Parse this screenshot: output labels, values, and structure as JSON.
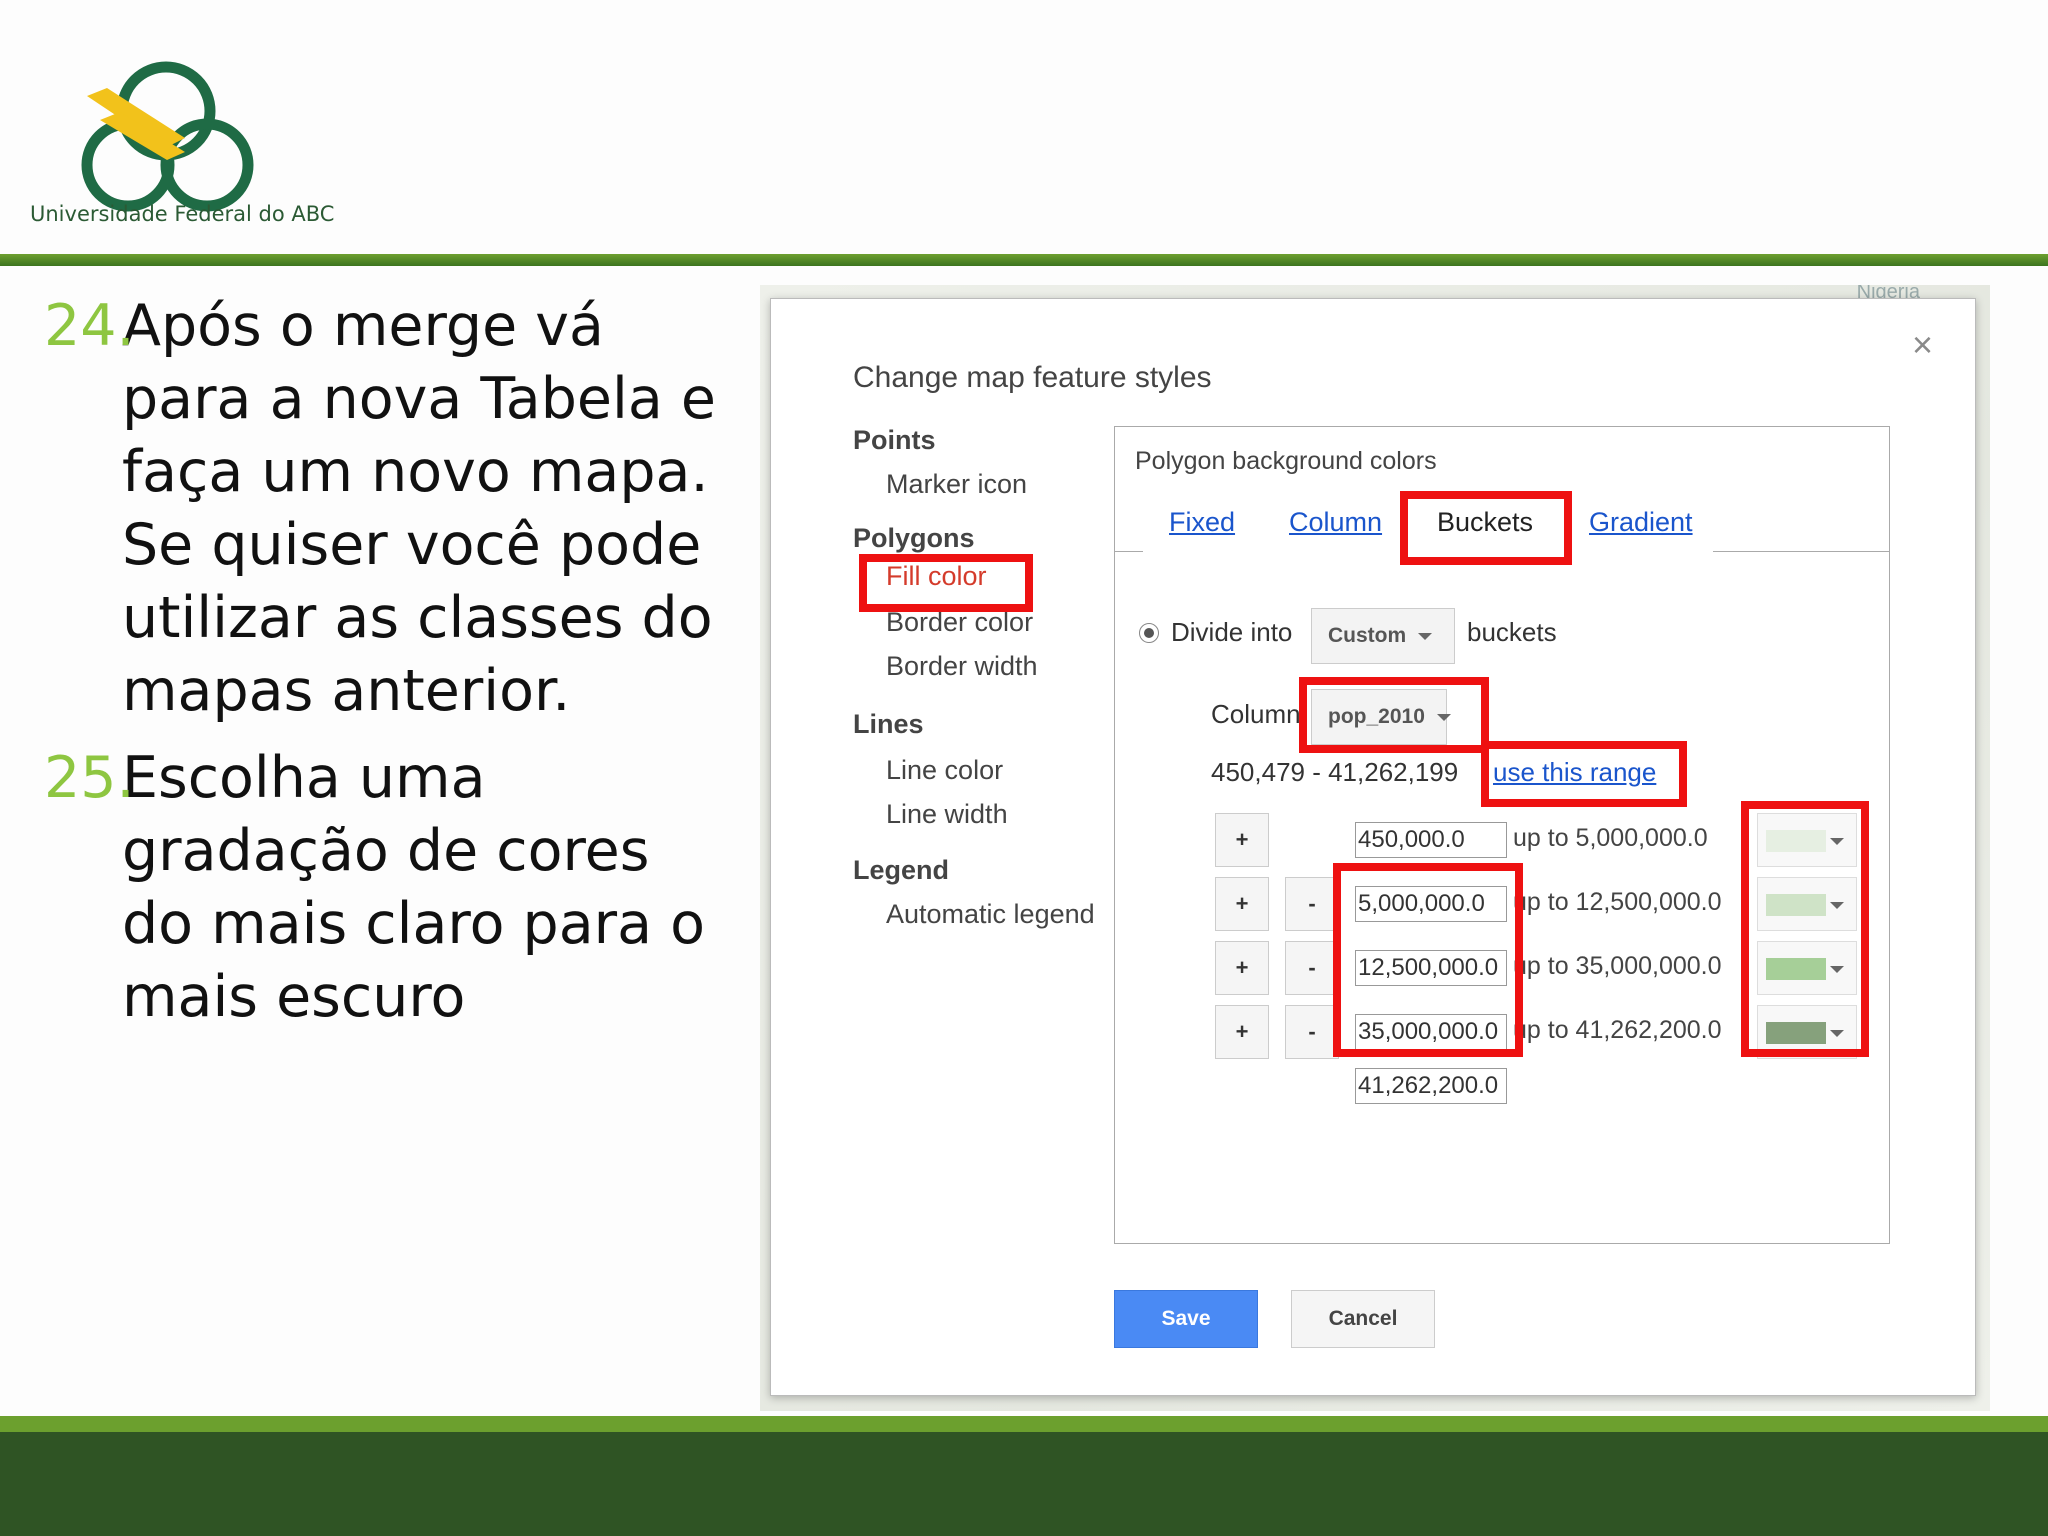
{
  "header": {
    "logo_text": "Universidade Federal do ABC"
  },
  "steps": [
    {
      "num": "24.",
      "first": "Após o merge vá",
      "rest": [
        "para a nova Tabela e",
        "faça um novo mapa.",
        "Se quiser você pode",
        "utilizar as classes do",
        "mapas anterior."
      ]
    },
    {
      "num": "25.",
      "first": "Escolha uma",
      "rest": [
        "gradação de cores",
        "do mais claro para o",
        "mais escuro"
      ]
    }
  ],
  "dialog": {
    "title": "Change map feature styles",
    "close_icon": "×",
    "nav": {
      "points": "Points",
      "marker_icon": "Marker icon",
      "polygons": "Polygons",
      "fill_color": "Fill color",
      "border_color": "Border color",
      "border_width": "Border width",
      "lines": "Lines",
      "line_color": "Line color",
      "line_width": "Line width",
      "legend": "Legend",
      "automatic_legend": "Automatic legend"
    },
    "panel": {
      "title": "Polygon background colors",
      "tabs": [
        "Fixed",
        "Column",
        "Buckets",
        "Gradient"
      ],
      "active_tab": "Buckets",
      "divide_into": "Divide into",
      "divide_select": "Custom",
      "buckets_label": "buckets",
      "column_label": "Column",
      "column_select": "pop_2010",
      "range_text": "450,479 - 41,262,199",
      "use_range_link": "use this range",
      "plus": "+",
      "minus": "-",
      "rows": [
        {
          "from": "450,000.0",
          "upto": "up to 5,000,000.0",
          "color": "#e6efe2",
          "has_minus": false
        },
        {
          "from": "5,000,000.0",
          "upto": "up to 12,500,000.0",
          "color": "#cfe3c7",
          "has_minus": true
        },
        {
          "from": "12,500,000.0",
          "upto": "up to 35,000,000.0",
          "color": "#a6cf98",
          "has_minus": true
        },
        {
          "from": "35,000,000.0",
          "upto": "up to 41,262,200.0",
          "color": "#86a17c",
          "has_minus": true
        }
      ],
      "last_value": "41,262,200.0"
    },
    "save": "Save",
    "cancel": "Cancel"
  },
  "map_label": "Nigeria",
  "colors": {
    "highlight": "#ee1111",
    "green_light": "#6ca02e",
    "green_dark": "#2f5424",
    "number_green": "#8ec641",
    "save_blue": "#4a8af4"
  }
}
